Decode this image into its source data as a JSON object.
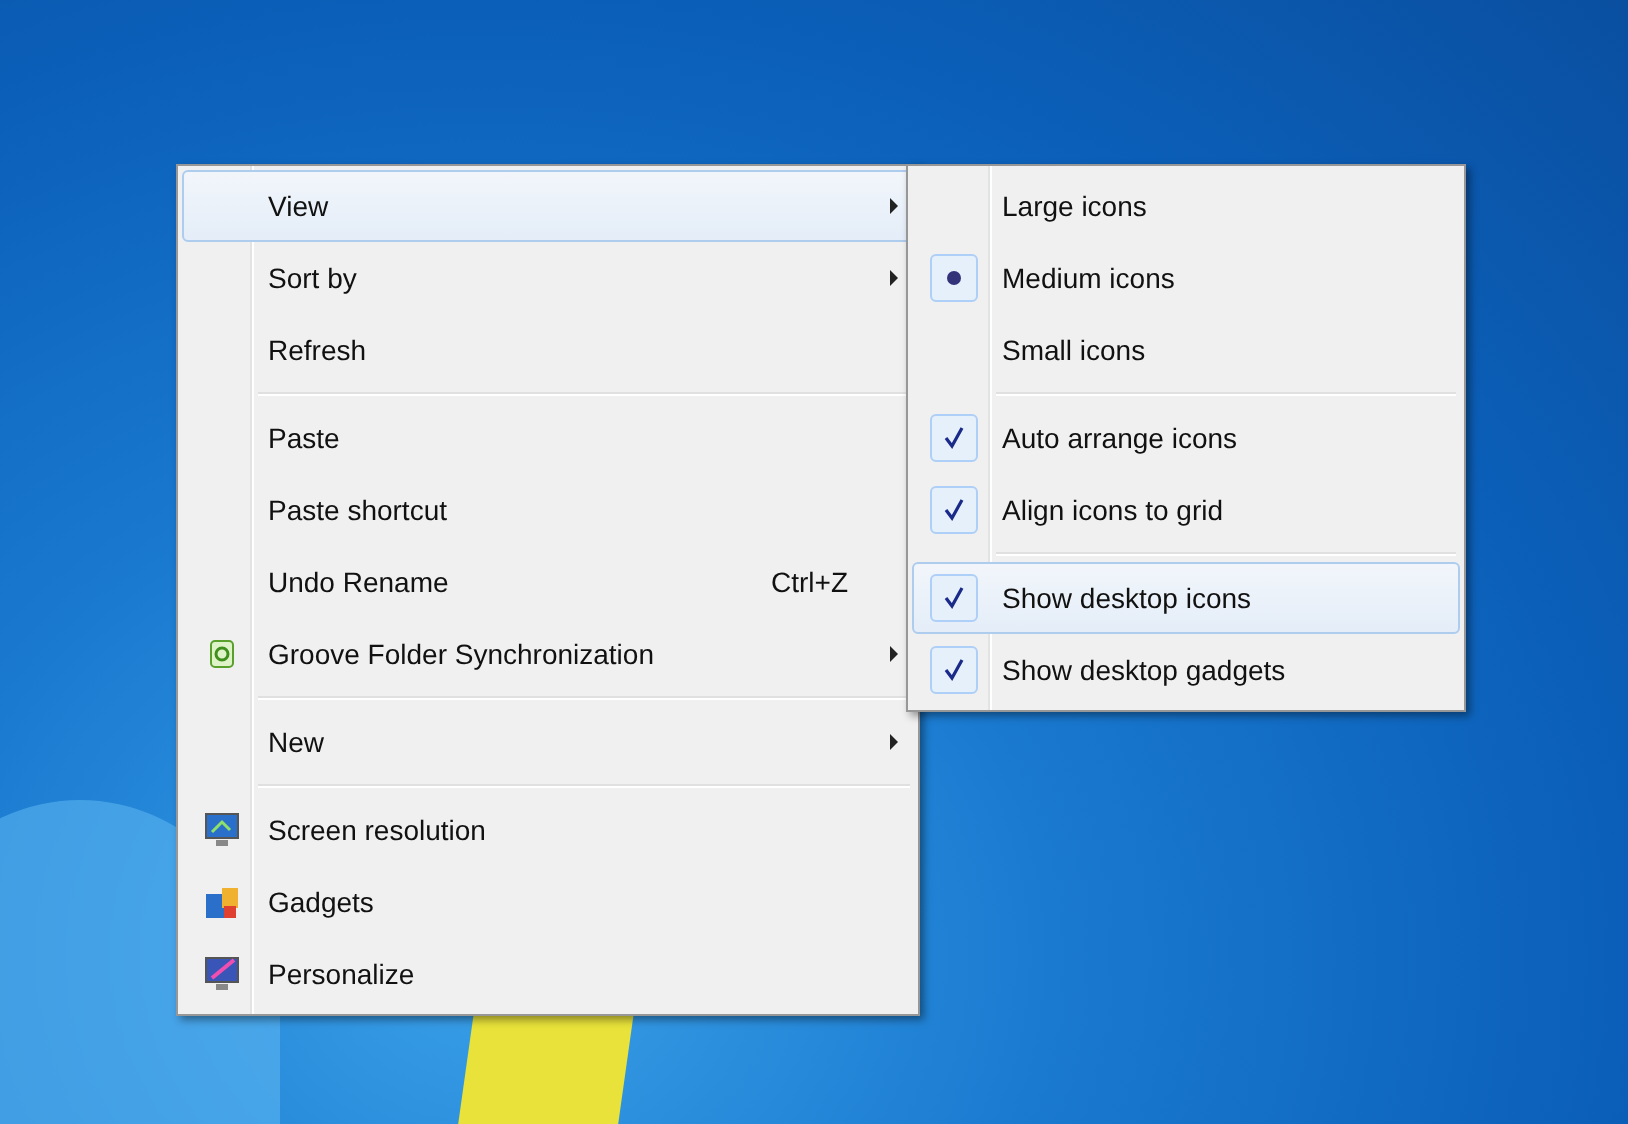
{
  "context_menu": {
    "groups": [
      [
        {
          "label": "View",
          "submenu": true,
          "selected": true
        },
        {
          "label": "Sort by",
          "submenu": true,
          "selected": false
        },
        {
          "label": "Refresh",
          "submenu": false,
          "selected": false
        }
      ],
      [
        {
          "label": "Paste",
          "submenu": false,
          "selected": false
        },
        {
          "label": "Paste shortcut",
          "submenu": false,
          "selected": false
        },
        {
          "label": "Undo Rename",
          "shortcut": "Ctrl+Z",
          "submenu": false,
          "selected": false
        },
        {
          "label": "Groove Folder Synchronization",
          "kind": "sync",
          "submenu": true,
          "selected": false
        }
      ],
      [
        {
          "label": "New",
          "submenu": true,
          "selected": false
        }
      ],
      [
        {
          "label": "Screen resolution",
          "kind": "monitor",
          "submenu": false,
          "selected": false
        },
        {
          "label": "Gadgets",
          "kind": "gadgets",
          "submenu": false,
          "selected": false
        },
        {
          "label": "Personalize",
          "kind": "personalize",
          "submenu": false,
          "selected": false
        }
      ]
    ]
  },
  "view_submenu": {
    "groups": [
      [
        {
          "label": "Large icons",
          "checked": false,
          "selected": false
        },
        {
          "label": "Medium icons",
          "kind": "radio",
          "checked": true,
          "selected": false
        },
        {
          "label": "Small icons",
          "checked": false,
          "selected": false
        }
      ],
      [
        {
          "label": "Auto arrange icons",
          "kind": "check",
          "checked": true,
          "selected": false
        },
        {
          "label": "Align icons to grid",
          "kind": "check",
          "checked": true,
          "selected": false
        }
      ],
      [
        {
          "label": "Show desktop icons",
          "kind": "check",
          "checked": true,
          "selected": true
        },
        {
          "label": "Show desktop gadgets",
          "kind": "check",
          "checked": true,
          "selected": false
        }
      ]
    ]
  }
}
